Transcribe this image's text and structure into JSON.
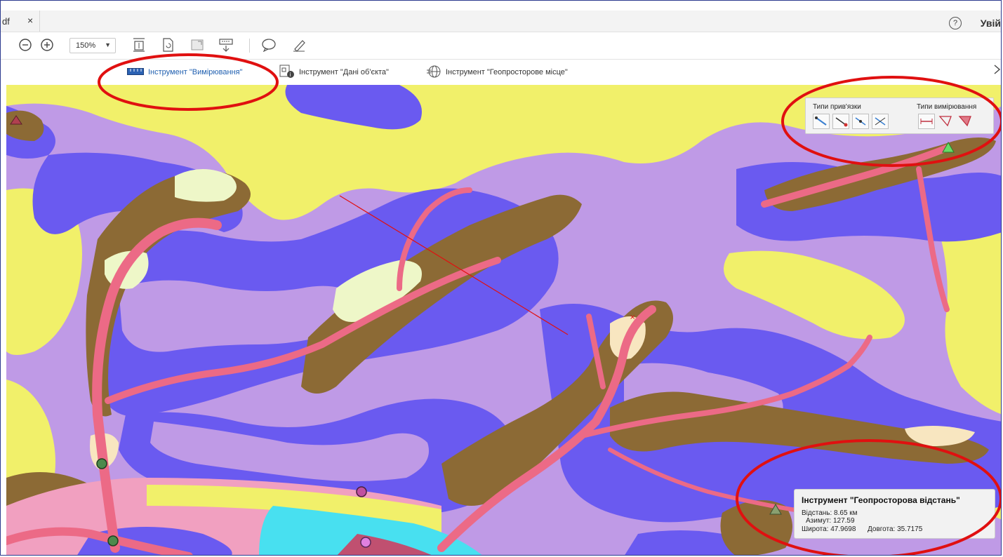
{
  "tab": {
    "label": "df",
    "close": "×"
  },
  "header": {
    "help_label": "?",
    "signin_label": "Увій"
  },
  "toolbar": {
    "zoom_value": "150%",
    "icons": [
      "zoom-out-icon",
      "zoom-in-icon",
      "fit-page-icon",
      "rotate-page-icon",
      "full-screen-icon",
      "page-display-icon",
      "comment-icon",
      "highlight-icon"
    ]
  },
  "tools": {
    "measure_label": "Інструмент \"Вимірювання\"",
    "object_data_label": "Інструмент \"Дані об'єкта\"",
    "geo_location_label": "Інструмент \"Геопросторове місце\"",
    "close_label": "×"
  },
  "snap_panel": {
    "snap_types_label": "Типи прив'язки",
    "measure_types_label": "Типи вимірювання"
  },
  "info_panel": {
    "title": "Інструмент \"Геопросторова відстань\"",
    "distance": "Відстань: 8.65 км",
    "azimuth": "Азимут: 127.59",
    "latitude": "Широта: 47.9698",
    "longitude": "Довгота: 35.7175"
  },
  "colors": {
    "yellow": "#f1f06a",
    "lilac": "#bf9ae6",
    "blue": "#6a5af0",
    "brown": "#8c6a35",
    "pink": "#ec6a86",
    "cream": "#f8e6c0",
    "annotation_red": "#e01010",
    "accent_blue": "#1f5fb0"
  }
}
